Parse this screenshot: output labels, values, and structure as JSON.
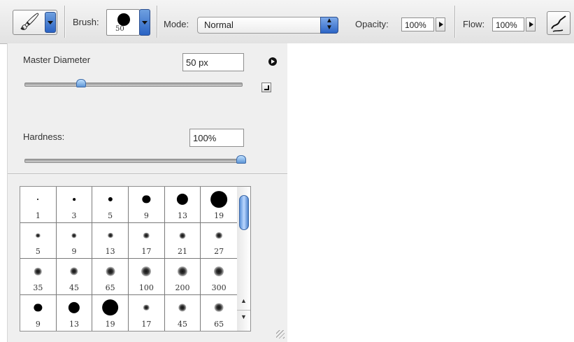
{
  "options_bar": {
    "tool_preset_icon": "paintbrush-icon",
    "brush_label": "Brush:",
    "brush_size": "50",
    "mode_label": "Mode:",
    "mode_value": "Normal",
    "opacity_label": "Opacity:",
    "opacity_value": "100%",
    "flow_label": "Flow:",
    "flow_value": "100%",
    "airbrush_icon": "airbrush-icon"
  },
  "brush_panel": {
    "master_diameter_label": "Master Diameter",
    "master_diameter_value": "50 px",
    "master_diameter_slider_fraction": 0.26,
    "hardness_label": "Hardness:",
    "hardness_value": "100%",
    "hardness_slider_fraction": 1.0,
    "presets": [
      {
        "size": "1",
        "style": "hard"
      },
      {
        "size": "3",
        "style": "hard"
      },
      {
        "size": "5",
        "style": "hard"
      },
      {
        "size": "9",
        "style": "hard"
      },
      {
        "size": "13",
        "style": "hard"
      },
      {
        "size": "19",
        "style": "hard"
      },
      {
        "size": "5",
        "style": "soft"
      },
      {
        "size": "9",
        "style": "soft"
      },
      {
        "size": "13",
        "style": "soft"
      },
      {
        "size": "17",
        "style": "soft"
      },
      {
        "size": "21",
        "style": "soft"
      },
      {
        "size": "27",
        "style": "soft"
      },
      {
        "size": "35",
        "style": "soft"
      },
      {
        "size": "45",
        "style": "soft"
      },
      {
        "size": "65",
        "style": "soft"
      },
      {
        "size": "100",
        "style": "soft"
      },
      {
        "size": "200",
        "style": "soft"
      },
      {
        "size": "300",
        "style": "soft"
      },
      {
        "size": "9",
        "style": "hard"
      },
      {
        "size": "13",
        "style": "hard"
      },
      {
        "size": "19",
        "style": "hard"
      },
      {
        "size": "17",
        "style": "soft"
      },
      {
        "size": "45",
        "style": "soft"
      },
      {
        "size": "65",
        "style": "soft"
      }
    ]
  }
}
